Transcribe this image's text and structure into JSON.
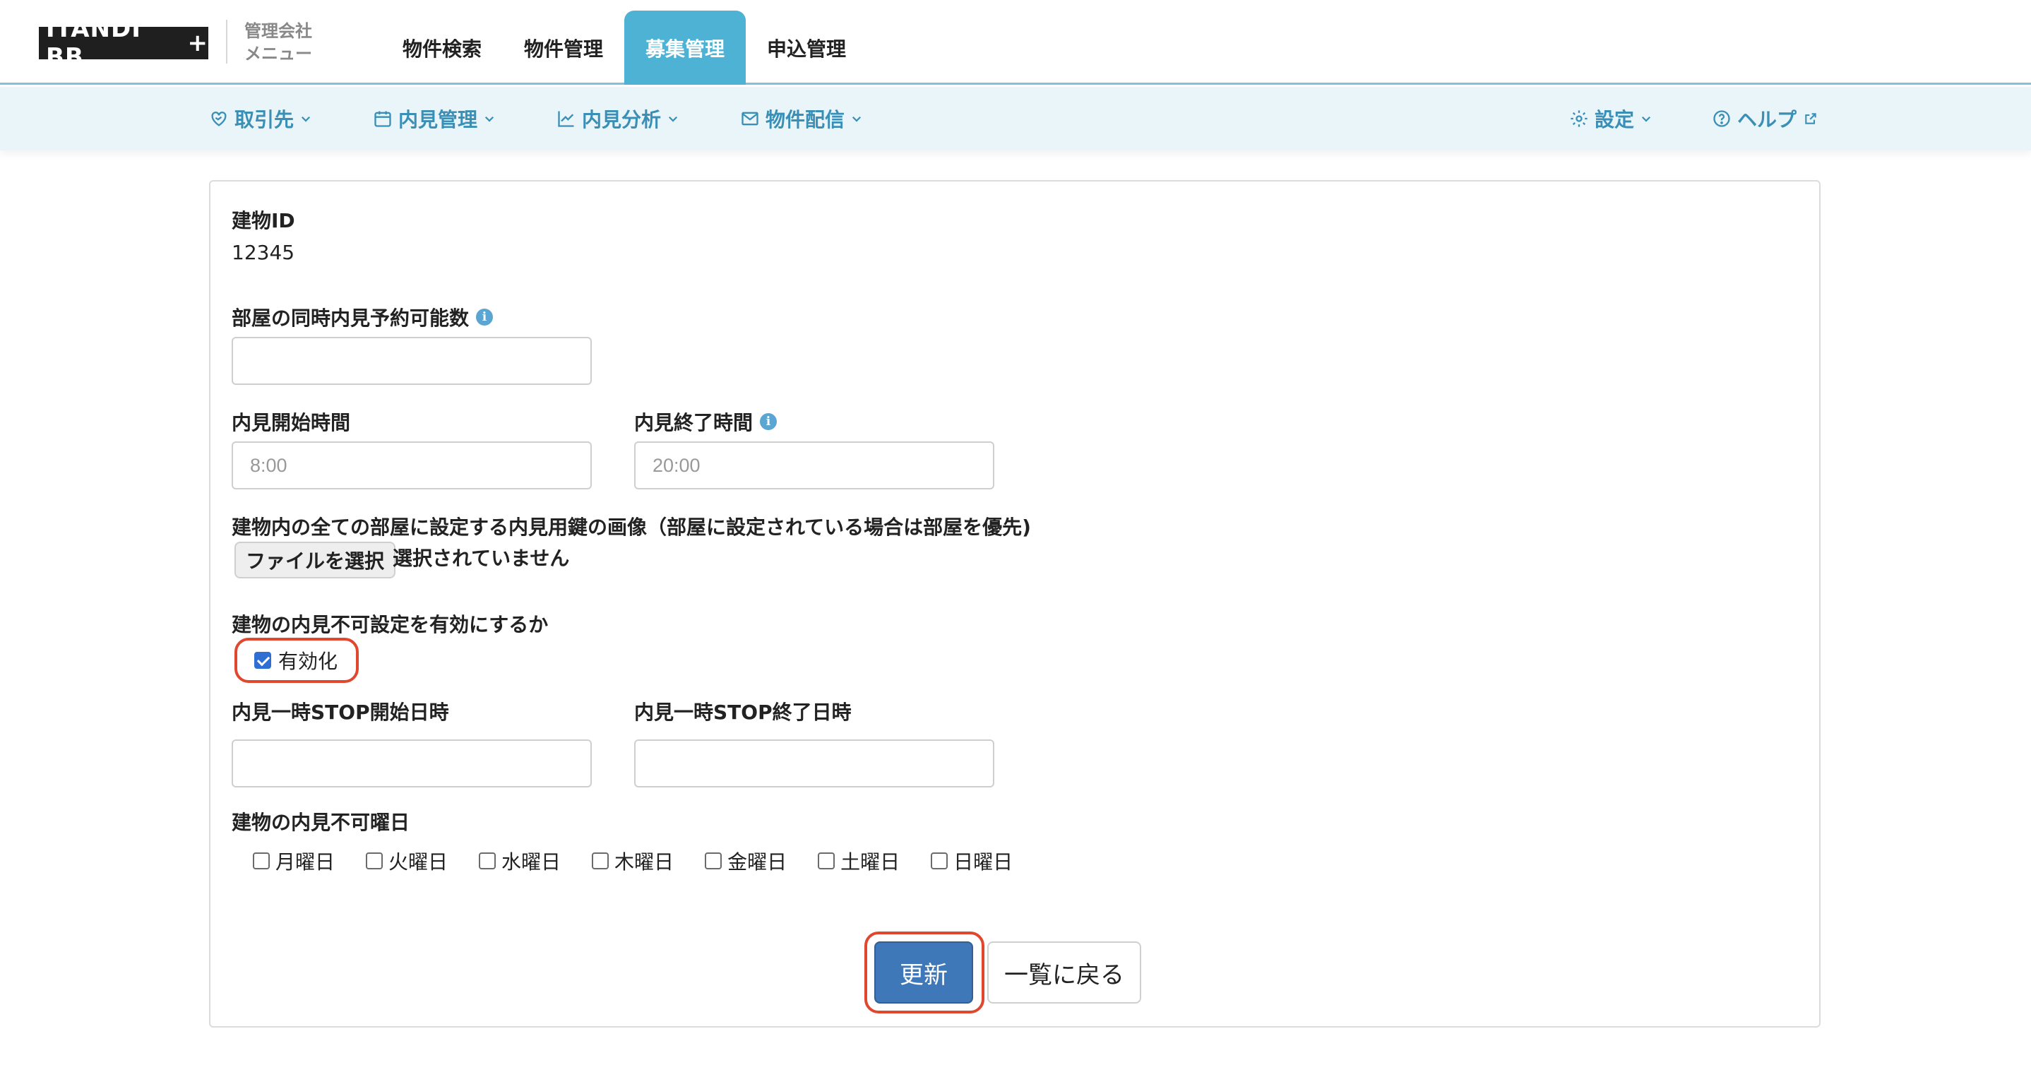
{
  "header": {
    "logo_text": "ITANDI BB",
    "logo_mark": "+",
    "mgmt_menu_line1": "管理会社",
    "mgmt_menu_line2": "メニュー",
    "tabs": [
      {
        "label": "物件検索",
        "active": false
      },
      {
        "label": "物件管理",
        "active": false
      },
      {
        "label": "募集管理",
        "active": true
      },
      {
        "label": "申込管理",
        "active": false
      }
    ],
    "accent_color": "#4db2d4"
  },
  "subnav": {
    "items": [
      {
        "label": "取引先",
        "icon": "handshake-heart-icon"
      },
      {
        "label": "内見管理",
        "icon": "calendar-icon"
      },
      {
        "label": "内見分析",
        "icon": "line-chart-icon"
      },
      {
        "label": "物件配信",
        "icon": "mail-icon"
      }
    ],
    "settings_label": "設定",
    "settings_icon": "gear-icon",
    "help_label": "ヘルプ",
    "help_icon": "question-circle-icon"
  },
  "form": {
    "building_id_label": "建物ID",
    "building_id_value": "12345",
    "concurrent_label": "部屋の同時内見予約可能数",
    "concurrent_value": "",
    "start_time_label": "内見開始時間",
    "start_time_placeholder": "8:00",
    "end_time_label": "内見終了時間",
    "end_time_placeholder": "20:00",
    "key_image_label": "建物内の全ての部屋に設定する内見用鍵の画像（部屋に設定されている場合は部屋を優先)",
    "file_button_label": "ファイルを選択",
    "file_status": "選択されていません",
    "disable_setting_label": "建物の内見不可設定を有効にするか",
    "enable_checkbox_label": "有効化",
    "enable_checked": true,
    "stop_start_label": "内見一時STOP開始日時",
    "stop_start_value": "",
    "stop_end_label": "内見一時STOP終了日時",
    "stop_end_value": "",
    "weekdays_label": "建物の内見不可曜日",
    "weekdays": [
      {
        "label": "月曜日",
        "checked": false
      },
      {
        "label": "火曜日",
        "checked": false
      },
      {
        "label": "水曜日",
        "checked": false
      },
      {
        "label": "木曜日",
        "checked": false
      },
      {
        "label": "金曜日",
        "checked": false
      },
      {
        "label": "土曜日",
        "checked": false
      },
      {
        "label": "日曜日",
        "checked": false
      }
    ],
    "update_button": "更新",
    "back_button": "一覧に戻る",
    "highlight_color": "#e0472e",
    "primary_color": "#3f78b8"
  }
}
